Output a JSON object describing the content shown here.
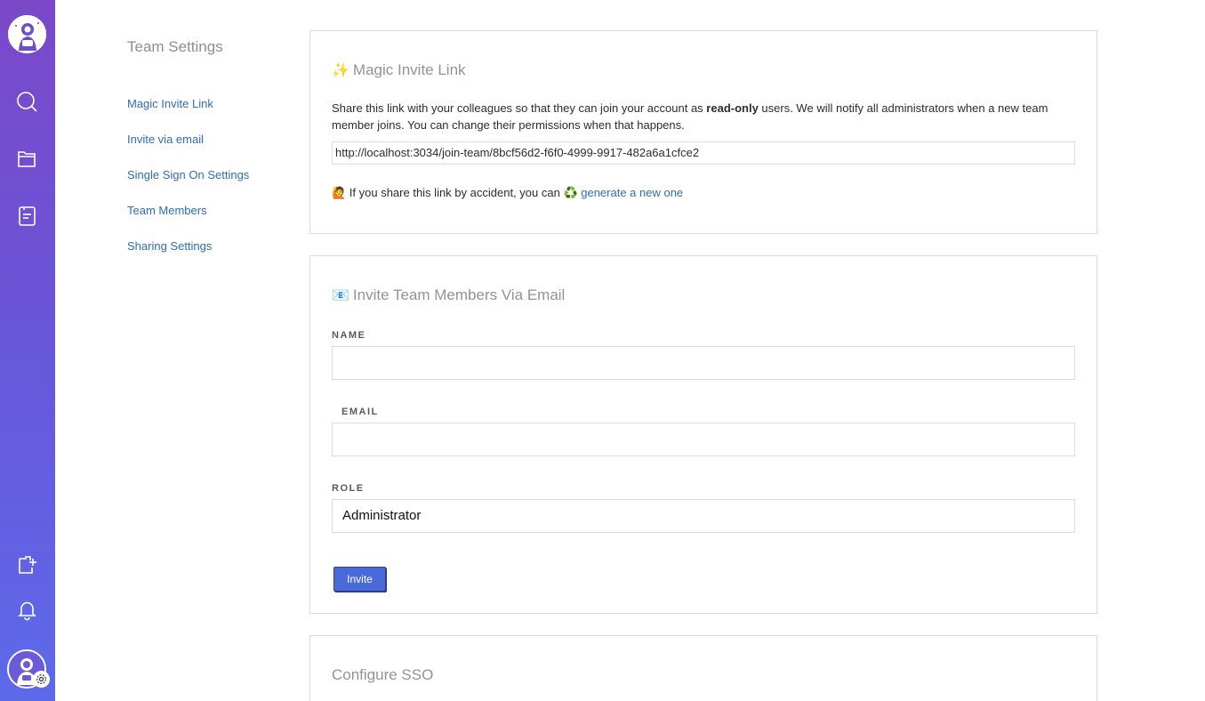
{
  "settings_nav": {
    "title": "Team Settings",
    "items": [
      {
        "label": "Magic Invite Link"
      },
      {
        "label": "Invite via email"
      },
      {
        "label": "Single Sign On Settings"
      },
      {
        "label": "Team Members"
      },
      {
        "label": "Sharing Settings"
      }
    ]
  },
  "magic_link": {
    "emoji": "✨",
    "title": "Magic Invite Link",
    "desc_before": "Share this link with your colleagues so that they can join your account as ",
    "desc_bold": "read-only",
    "desc_after": " users. We will notify all administrators when a new team member joins. You can change their permissions when that happens.",
    "url": "http://localhost:3034/join-team/8bcf56d2-f6f0-4999-9917-482a6a1cfce2",
    "hint_emoji": "🙋",
    "hint_text": " If you share this link by accident, you can ",
    "regen_emoji": "♻️",
    "regen_label": " generate a new one"
  },
  "invite_email": {
    "emoji": "📧",
    "title": "Invite Team Members Via Email",
    "name_label": "NAME",
    "email_label": "EMAIL",
    "role_label": "ROLE",
    "role_value": "Administrator",
    "button": "Invite"
  },
  "sso": {
    "title": "Configure SSO"
  },
  "rail": {
    "icons": [
      "search-icon",
      "folder-icon",
      "document-icon",
      "new-document-icon",
      "bell-icon",
      "settings-gear-icon"
    ],
    "gradient_top": "#7b48c9",
    "gradient_bottom": "#5c6aea"
  }
}
